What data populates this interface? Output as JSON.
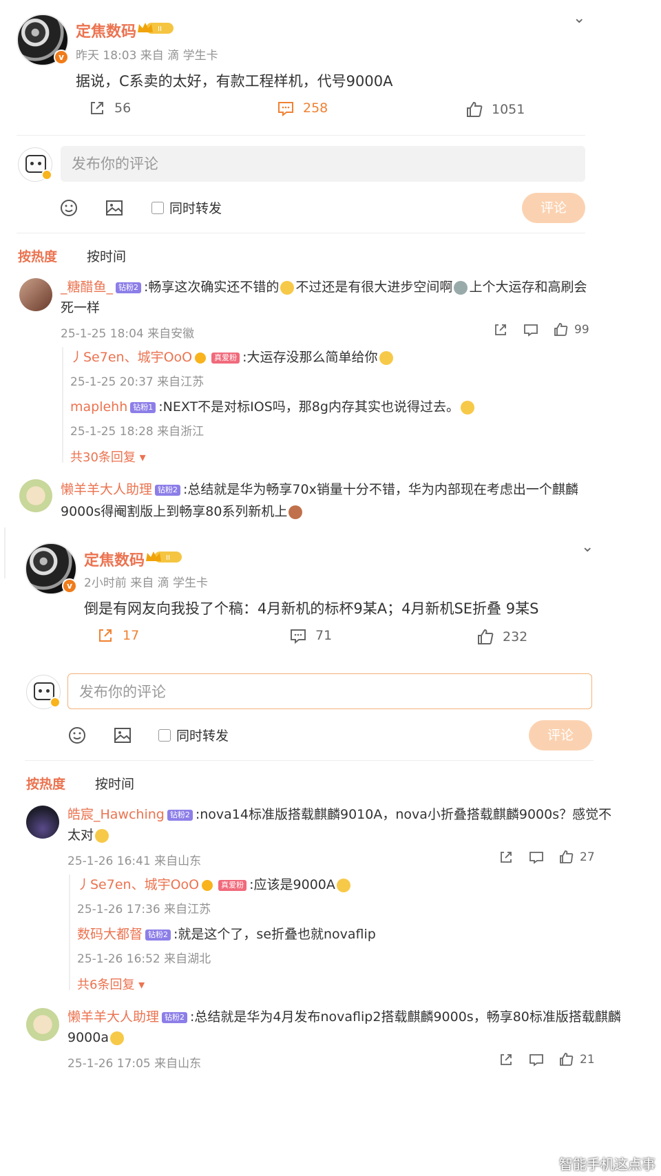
{
  "post1": {
    "author": "定焦数码",
    "meta": "昨天 18:03 来自 滴 学生卡",
    "text": "据说，C系卖的太好，有款工程样机，代号9000A",
    "repost_count": "56",
    "comment_count": "258",
    "like_count": "1051",
    "comment_placeholder": "发布你的评论",
    "also_repost": "同时转发",
    "submit": "评论",
    "sort_hot": "按热度",
    "sort_time": "按时间",
    "comments": [
      {
        "name": "_糖醋鱼_",
        "fan": "钻粉2",
        "text1": ":畅享这次确实还不错的",
        "text2": "不过还是有很大进步空间啊",
        "text3": "上个大运存和高刷会",
        "text4": "死一样",
        "meta": "25-1-25 18:04 来自安徽",
        "likes": "99"
      },
      {
        "name": "丿Se7en、城宇OoO",
        "fan": "真爱粉",
        "text": ":大运存没那么简单给你",
        "meta": "25-1-25 20:37 来自江苏"
      },
      {
        "name": "maplehh",
        "fan": "钻粉1",
        "text": ":NEXT不是对标IOS吗，那8g内存其实也说得过去。",
        "meta": "25-1-25 18:28 来自浙江"
      },
      {
        "more": "共30条回复"
      },
      {
        "name": "懒羊羊大人助理",
        "fan": "钻粉2",
        "text1": ":总结就是华为畅享70x销量十分不错，华为内部现在考虑出一个麒麟",
        "text2": "9000s得阉割版上到畅享80系列新机上"
      }
    ]
  },
  "post2": {
    "author": "定焦数码",
    "meta": "2小时前 来自 滴 学生卡",
    "text": "倒是有网友向我投了个稿：4月新机的标杯9某A；4月新机SE折叠 9某S",
    "repost_count": "17",
    "comment_count": "71",
    "like_count": "232",
    "comment_placeholder": "发布你的评论",
    "also_repost": "同时转发",
    "submit": "评论",
    "sort_hot": "按热度",
    "sort_time": "按时间",
    "comments": [
      {
        "name": "皓宸_Hawching",
        "fan": "钻粉2",
        "text1": ":nova14标准版搭载麒麟9010A，nova小折叠搭载麒麟9000s？感觉不",
        "text2": "太对",
        "meta": "25-1-26 16:41 来自山东",
        "likes": "27"
      },
      {
        "name": "丿Se7en、城宇OoO",
        "fan": "真爱粉",
        "text": ":应该是9000A",
        "meta": "25-1-26 17:36 来自江苏"
      },
      {
        "name": "数码大都督",
        "fan": "钻粉2",
        "text": ":就是这个了，se折叠也就novaflip",
        "meta": "25-1-26 16:52 来自湖北"
      },
      {
        "more": "共6条回复"
      },
      {
        "name": "懒羊羊大人助理",
        "fan": "钻粉2",
        "text1": ":总结就是华为4月发布novaflip2搭载麒麟9000s，畅享80标准版搭载麒麟",
        "text2": "9000a",
        "meta": "25-1-26 17:05 来自山东",
        "likes": "21"
      }
    ]
  },
  "watermark": "智能手机这点事",
  "colors": {
    "accent": "#eb7350",
    "orange": "#f08132",
    "submit_bg": "#fbd2b1"
  }
}
